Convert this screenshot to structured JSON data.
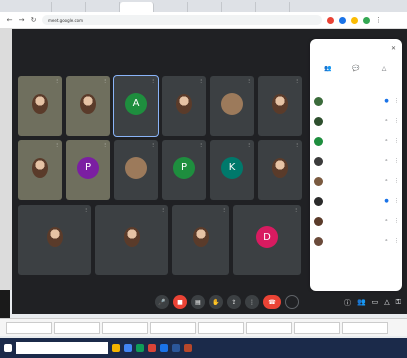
{
  "browser": {
    "tabs": [
      "",
      "",
      "",
      "",
      "",
      "",
      "",
      ""
    ],
    "active_tab": 3,
    "url": "meet.google.com"
  },
  "meeting": {
    "banner": "",
    "meeting_code": "",
    "tiles": [
      {
        "name": "",
        "type": "photo",
        "x": 4
      },
      {
        "name": "",
        "type": "photo",
        "x": 4
      },
      {
        "name": "",
        "type": "letter",
        "letter": "A",
        "color": "#1e8e3e",
        "highlight": true
      },
      {
        "name": "",
        "type": "photo"
      },
      {
        "name": "",
        "type": "letter",
        "letter": "",
        "color": "#9c7a5b"
      },
      {
        "name": "",
        "type": "photo"
      },
      {
        "name": "",
        "type": "photo"
      },
      {
        "name": "",
        "type": "letter",
        "letter": "P",
        "color": "#7b1fa2"
      },
      {
        "name": "",
        "type": "letter",
        "letter": "",
        "color": "#9c7a5b"
      },
      {
        "name": "",
        "type": "letter",
        "letter": "P",
        "color": "#1e8e3e"
      },
      {
        "name": "",
        "type": "letter",
        "letter": "K",
        "color": "#00796b"
      },
      {
        "name": "",
        "type": "photo"
      },
      {
        "name": "",
        "type": "photo"
      },
      {
        "name": "",
        "type": "photo"
      },
      {
        "name": "",
        "type": "photo"
      },
      {
        "name": "",
        "type": "letter",
        "letter": "D",
        "color": "#d81b60"
      }
    ]
  },
  "people_panel": {
    "title": "",
    "tabs": [
      {
        "label": "",
        "icon": "people-icon"
      },
      {
        "label": "",
        "icon": "chat-icon"
      },
      {
        "label": "",
        "icon": "activities-icon"
      }
    ],
    "participants": [
      {
        "name": "",
        "color": "#3b6b3b"
      },
      {
        "name": "",
        "color": "#2e4f2e"
      },
      {
        "name": "",
        "color": "#1e8e3e"
      },
      {
        "name": "",
        "color": "#3b3b3b"
      },
      {
        "name": "",
        "color": "#7a5a40"
      },
      {
        "name": "",
        "color": "#2b2b2b"
      },
      {
        "name": "",
        "color": "#5a3b2a"
      },
      {
        "name": "",
        "color": "#6a4a3a"
      }
    ]
  },
  "taskbar": {
    "search_placeholder": "",
    "windows": [
      "",
      "",
      "",
      "",
      "",
      "",
      "",
      ""
    ],
    "clock": ""
  }
}
